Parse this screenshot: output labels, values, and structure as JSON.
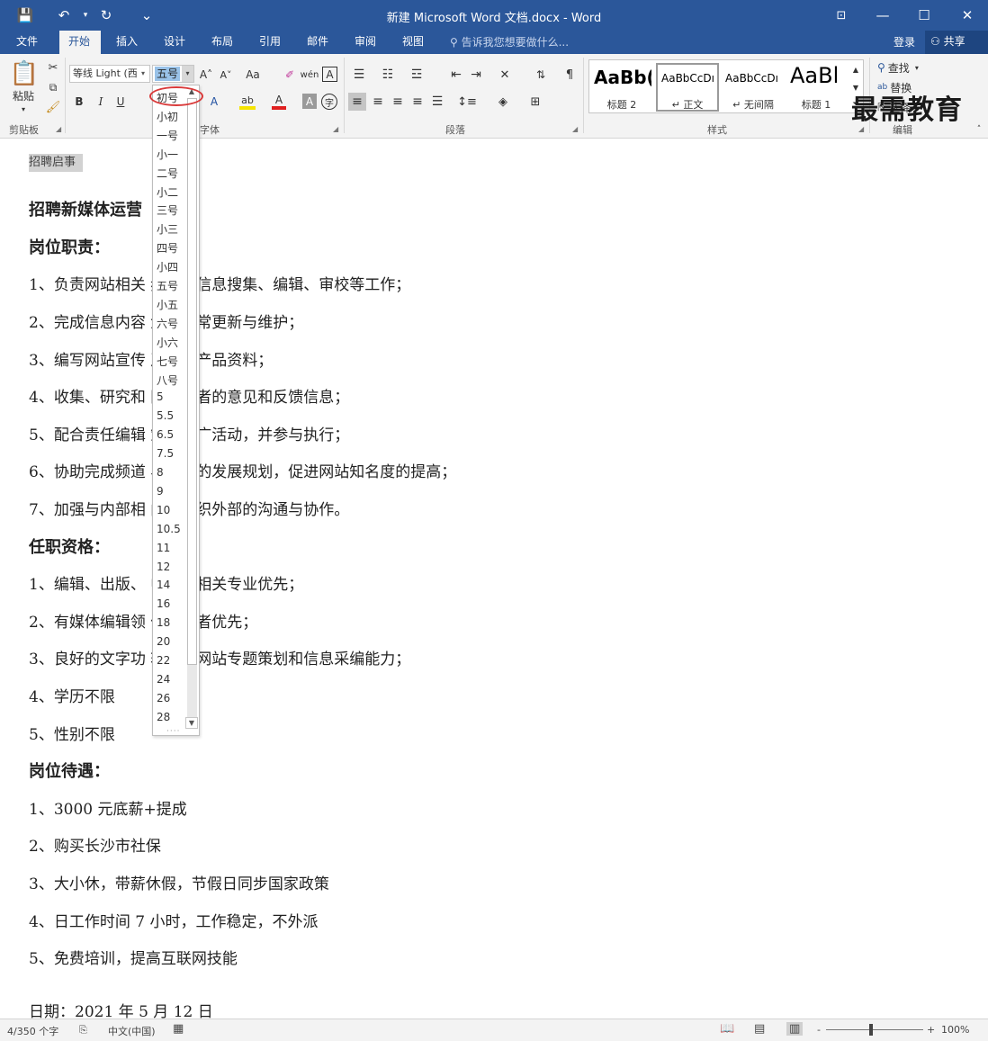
{
  "window": {
    "title": "新建 Microsoft Word 文档.docx - Word",
    "controls": {
      "ribbon_display": "⊡",
      "minimize": "—",
      "maximize": "☐",
      "close": "✕"
    }
  },
  "qat": {
    "save": "💾",
    "undo": "↶",
    "redo": "↻",
    "customize": "⌄"
  },
  "tabs": [
    "文件",
    "开始",
    "插入",
    "设计",
    "布局",
    "引用",
    "邮件",
    "审阅",
    "视图"
  ],
  "active_tab": "开始",
  "tell_me": "告诉我您想要做什么...",
  "login_label": "登录",
  "share_label": "共享",
  "ribbon": {
    "clipboard": {
      "paste": "粘贴",
      "label": "剪贴板"
    },
    "font": {
      "name": "等线 Light (西",
      "size": "五号",
      "label": "字体",
      "grow": "A˄",
      "shrink": "A˅",
      "case": "Aa",
      "clear": "✐",
      "phonetic": "wén",
      "border": "A",
      "bold": "B",
      "italic": "I",
      "underline": "U",
      "strike": "abc",
      "sub": "x₂",
      "super": "x²",
      "effects": "A",
      "highlight": "ab",
      "color": "A",
      "shade": "A",
      "circle": "字"
    },
    "paragraph": {
      "label": "段落"
    },
    "styles": {
      "label": "样式",
      "items": [
        {
          "sample": "AaBb(",
          "name": "标题 2"
        },
        {
          "sample": "AaBbCcDı",
          "name": "↵ 正文"
        },
        {
          "sample": "AaBbCcDı",
          "name": "↵ 无间隔"
        },
        {
          "sample": "AaBl",
          "name": "标题 1"
        }
      ]
    },
    "editing": {
      "find": "查找",
      "replace": "替换",
      "select": "选择",
      "label": "编辑"
    }
  },
  "font_size_options": [
    "初号",
    "小初",
    "一号",
    "小一",
    "二号",
    "小二",
    "三号",
    "小三",
    "四号",
    "小四",
    "五号",
    "小五",
    "六号",
    "小六",
    "七号",
    "八号",
    "5",
    "5.5",
    "6.5",
    "7.5",
    "8",
    "9",
    "10",
    "10.5",
    "11",
    "12",
    "14",
    "16",
    "18",
    "20",
    "22",
    "24",
    "26",
    "28"
  ],
  "document": {
    "tag": "招聘启事",
    "lines": [
      {
        "text": "招聘新媒体运营",
        "heading": true
      },
      {
        "text": "岗位职责：",
        "heading": true
      },
      {
        "text": "1、负责网站相关  频道的信息搜集、编辑、审校等工作；"
      },
      {
        "text": "2、完成信息内容  划和日常更新与维护；"
      },
      {
        "text": "3、编写网站宣传  及相关产品资料；"
      },
      {
        "text": "4、收集、研究和  网络读者的意见和反馈信息；"
      },
      {
        "text": "5、配合责任编辑  策划推广活动，并参与执行；"
      },
      {
        "text": "6、协助完成频道  与栏目的发展规划，促进网站知名度的提高；"
      },
      {
        "text": "7、加强与内部相  门和组织外部的沟通与协作。"
      },
      {
        "text": "任职资格：",
        "heading": true
      },
      {
        "text": "1、编辑、出版、    中文等相关专业优先；"
      },
      {
        "text": "2、有媒体编辑领  作经验者优先；"
      },
      {
        "text": "3、良好的文字功  较强的网站专题策划和信息采编能力；"
      },
      {
        "text": "4、学历不限"
      },
      {
        "text": "5、性别不限"
      },
      {
        "text": "岗位待遇：",
        "heading": true
      },
      {
        "text": "1、3000 元底薪+提成"
      },
      {
        "text": "2、购买长沙市社保"
      },
      {
        "text": "3、大小休，带薪休假，节假日同步国家政策"
      },
      {
        "text": "4、日工作时间 7 小时，工作稳定，不外派"
      },
      {
        "text": "5、免费培训，提高互联网技能"
      },
      {
        "text": "日期：2021 年 5 月 12 日"
      }
    ]
  },
  "status": {
    "words": "4/350 个字",
    "language": "中文(中国)",
    "zoom": "100%",
    "zoom_minus": "-",
    "zoom_plus": "+"
  },
  "watermark": "最需教育",
  "colors": {
    "brand": "#2b579a",
    "highlight_ring": "#d93a3a",
    "selection": "#99c2e8"
  }
}
